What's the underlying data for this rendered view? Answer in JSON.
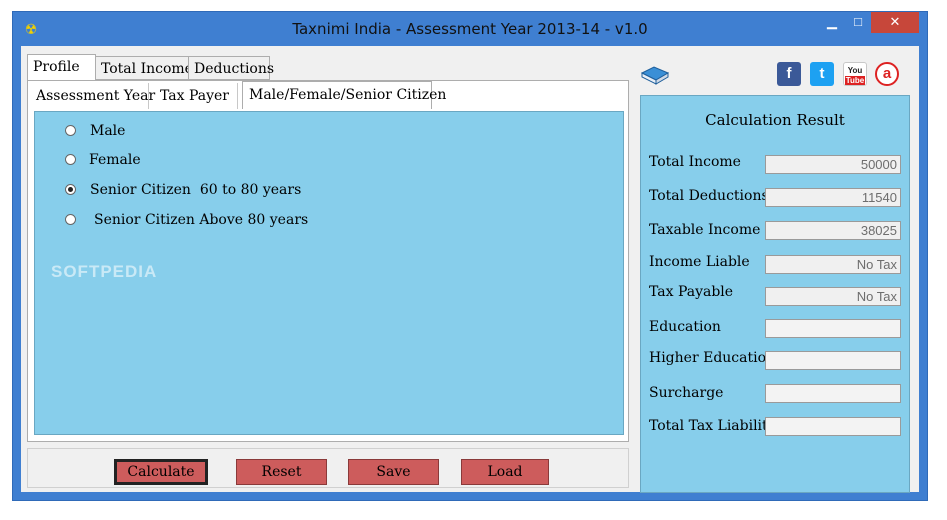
{
  "window": {
    "title": "Taxnimi India - Assessment Year 2013-14 - v1.0"
  },
  "tabs": [
    {
      "label": "Profile"
    },
    {
      "label": "Total Income"
    },
    {
      "label": "Deductions"
    }
  ],
  "subtabs": [
    {
      "label": "Assessment Year"
    },
    {
      "label": "Tax Payer"
    },
    {
      "label": "Male/Female/Senior Citizen"
    }
  ],
  "options": [
    {
      "label": "Male",
      "checked": false
    },
    {
      "label": "Female",
      "checked": false
    },
    {
      "label": "Senior Citizen  60 to 80 years",
      "checked": true
    },
    {
      "label": "Senior Citizen Above 80 years",
      "checked": false
    }
  ],
  "buttons": {
    "calculate": "Calculate",
    "reset": "Reset",
    "save": "Save",
    "load": "Load"
  },
  "result": {
    "title": "Calculation Result",
    "rows": [
      {
        "label": "Total Income",
        "value": "50000"
      },
      {
        "label": "Total Deductions",
        "value": "11540"
      },
      {
        "label": "Taxable Income",
        "value": "38025"
      },
      {
        "label": "Income Liable",
        "value": "No Tax"
      },
      {
        "label": "Tax Payable",
        "value": "No Tax"
      },
      {
        "label": "Education",
        "value": ""
      },
      {
        "label": "Higher Education",
        "value": ""
      },
      {
        "label": "Surcharge",
        "value": ""
      },
      {
        "label": "Total Tax Liability",
        "value": ""
      }
    ]
  },
  "social": {
    "facebook": "f",
    "twitter": "t",
    "youtube_top": "You",
    "youtube_bottom": "Tube",
    "app": "a"
  },
  "icons": {
    "app": "app-icon",
    "book": "book-icon",
    "minimize": "minimize-icon",
    "maximize": "maximize-icon",
    "close": "close-icon"
  },
  "watermark": "SOFTPEDIA",
  "colors": {
    "titlebar": "#3f7fd1",
    "panel": "#87ceeb",
    "button": "#cd5c5c",
    "close": "#c7473a"
  }
}
